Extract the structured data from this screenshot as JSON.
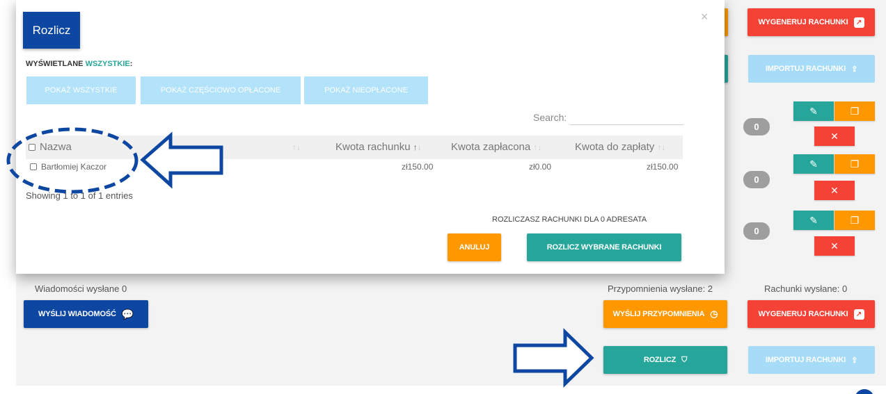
{
  "modal": {
    "title": "Rozlicz",
    "close": "×",
    "show_label_prefix": "WYŚWIETLANE",
    "show_label_value": "WSZYSTKIE",
    "show_label_suffix": ":",
    "filters": [
      "POKAŻ WSZYSTKIE",
      "POKAŻ CZĘŚCIOWO OPŁACONE",
      "POKAŻ NIEOPŁACONE"
    ],
    "search_label": "Search:",
    "search_value": "",
    "table": {
      "headers": [
        "Nazwa",
        "Kwota rachunku",
        "Kwota zapłacona",
        "Kwota do zapłaty"
      ],
      "rows": [
        {
          "name": "Bartłomiej Kaczor",
          "amount": "zł150.00",
          "paid": "zł0.00",
          "due": "zł150.00"
        }
      ]
    },
    "entries_info": "Showing 1 to 1 of 1 entries",
    "settlement_info": "ROZLICZASZ RACHUNKI DLA 0 ADRESATA",
    "cancel_label": "ANULUJ",
    "settle_selected_label": "ROZLICZ WYBRANE RACHUNKI"
  },
  "background": {
    "generate_label": "WYGENERUJ RACHUNKI",
    "import_label": "IMPORTUJ RACHUNKI",
    "badges": [
      "0",
      "0",
      "0"
    ],
    "messages_sent": "Wiadomości wysłane 0",
    "reminders_sent": "Przypomnienia wysłane: 2",
    "bills_sent": "Rachunki wysłane: 0",
    "send_message_label": "WYŚLIJ WIADOMOŚĆ",
    "send_reminders_label": "WYŚLIJ PRZYPOMNIENIA",
    "settle_label": "ROZLICZ"
  },
  "colors": {
    "primary_blue": "#0d47a1",
    "teal": "#26a69a",
    "orange": "#ff9800",
    "red": "#f44336",
    "light_blue": "#a6dcf8"
  }
}
